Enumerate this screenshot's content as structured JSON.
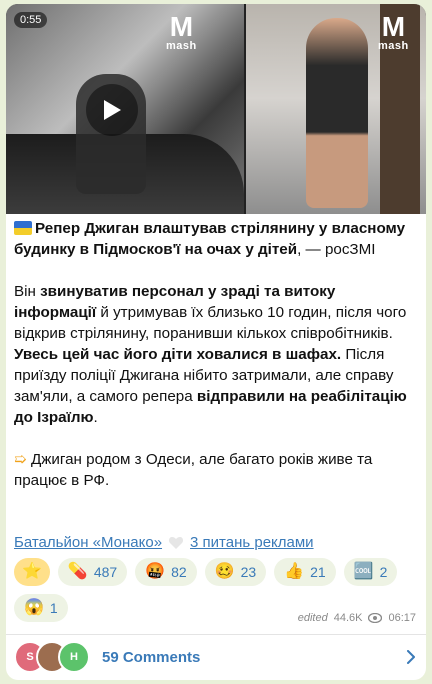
{
  "media": {
    "duration": "0:55",
    "logo_text": "mash"
  },
  "post": {
    "flag_icon": "ukraine-flag",
    "headline_bold": "Репер Джиган влаштував стрілянину у власному будинку в Підмосков'ї на очах у дітей",
    "headline_tail": ", — росЗМІ",
    "p1_a": "Він ",
    "p1_b": "звинуватив персонал у зраді та витоку інформації",
    "p1_c": " й утримував їх близько 10 годин, після чого відкрив стрілянину, поранивши кількох співробітників.",
    "p2_a": "Увесь цей час його діти ховалися в шафах.",
    "p2_b": " Після приїзду поліції Джигана нібито затримали, але справу зам'яли, а самого репера ",
    "p2_c": "відправили на реабілітацію до Ізраїлю",
    "p2_d": ".",
    "p3_icon": "pointing-hand-icon",
    "p3": "Джиган родом з Одеси, але багато років живе та працює в РФ."
  },
  "links": {
    "channel": "Батальйон «Монако»",
    "ads": "3 питань реклами"
  },
  "reactions": [
    {
      "icon": "star-icon",
      "count": ""
    },
    {
      "icon": "pill-icon",
      "count": "487"
    },
    {
      "icon": "angry-face-icon",
      "count": "82"
    },
    {
      "icon": "worried-face-icon",
      "count": "23"
    },
    {
      "icon": "thumbs-up-icon",
      "count": "21"
    },
    {
      "icon": "cool-icon",
      "count": "2"
    },
    {
      "icon": "scream-face-icon",
      "count": "1"
    }
  ],
  "meta": {
    "edited": "edited",
    "views": "44.6K",
    "time": "06:17"
  },
  "comments": {
    "avatars": [
      "S",
      "",
      "H"
    ],
    "label": "59 Comments"
  },
  "colors": {
    "accent": "#3a7ab8",
    "background": "#e9f0d9",
    "chip": "#eef3e4"
  }
}
